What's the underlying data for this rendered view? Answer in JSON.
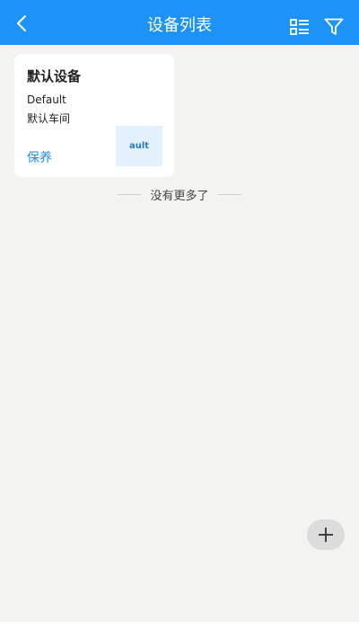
{
  "header": {
    "title": "设备列表",
    "back_icon": "chevron-left-icon",
    "list_view_icon": "list-view-icon",
    "filter_icon": "filter-icon",
    "background_color": "#1e93f7"
  },
  "devices": [
    {
      "name": "默认设备",
      "code": "Default",
      "location": "默认车间",
      "action_label": "保养",
      "thumbnail_text": "ault"
    }
  ],
  "list_end_text": "没有更多了",
  "fab": {
    "icon": "plus-icon"
  },
  "colors": {
    "accent": "#1a8fe0",
    "page_background": "#f3f3f1"
  }
}
